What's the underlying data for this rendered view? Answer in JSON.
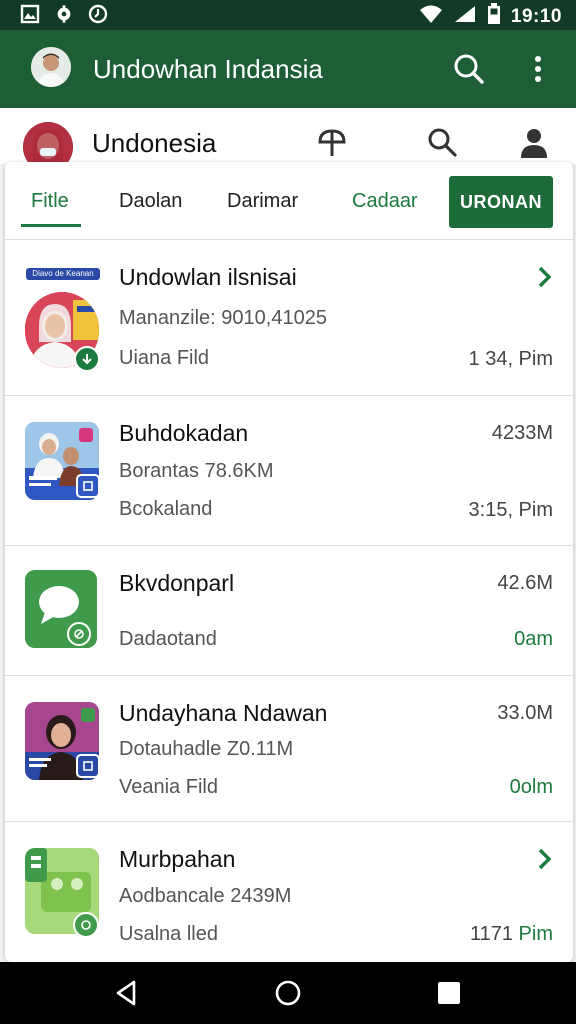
{
  "status_bar": {
    "time": "19:10",
    "icons": [
      "gallery-icon",
      "settings-icon",
      "alarm-icon",
      "wifi-icon",
      "signal-icon",
      "battery-icon"
    ]
  },
  "app_bar": {
    "title": "Undowhan Indansia",
    "icons": [
      "search-icon",
      "more-vert-icon"
    ],
    "background": "#1d5e36"
  },
  "sub_header": {
    "title": "Undonesia",
    "icons": [
      "tree-icon",
      "search-icon",
      "person-icon"
    ]
  },
  "tabs": [
    {
      "label": "Fitle",
      "active": true
    },
    {
      "label": "Daolan",
      "active": false
    },
    {
      "label": "Darimar",
      "active": false
    },
    {
      "label": "Cadaar",
      "active": false
    }
  ],
  "tab_button": {
    "label": "URONAN"
  },
  "rows": [
    {
      "title": "Undowlan ilsnisai",
      "line2": "Mananzile: 9010,41025",
      "line3": "Uiana Fild",
      "meta_top": "",
      "meta_bottom": "1 34, Pim",
      "thumb_badge": "Diavo de Keanan"
    },
    {
      "title": "Buhdokadan",
      "line2": "Borantas 78.6KM",
      "line3": "Bcokaland",
      "meta_top": "4233M",
      "meta_bottom": "3:15, Pim"
    },
    {
      "title": "Bkvdonparl",
      "line2": "",
      "line3": "Dadaotand",
      "meta_top": "42.6M",
      "meta_bottom": "0am"
    },
    {
      "title": "Undayhana Ndawan",
      "line2": "Dotauhadle Z0.11M",
      "line3": "Veania Fild",
      "meta_top": "33.0M",
      "meta_bottom": "0olm"
    },
    {
      "title": "Murbpahan",
      "line2": "Aodbancale 2439M",
      "line3": "Usalna lled",
      "meta_top": "",
      "meta_bottom_a": "1171",
      "meta_bottom_b": "Pim"
    }
  ],
  "colors": {
    "accent": "#1d7a3e",
    "status_bar": "#123a26",
    "button": "#1e6b3a"
  }
}
